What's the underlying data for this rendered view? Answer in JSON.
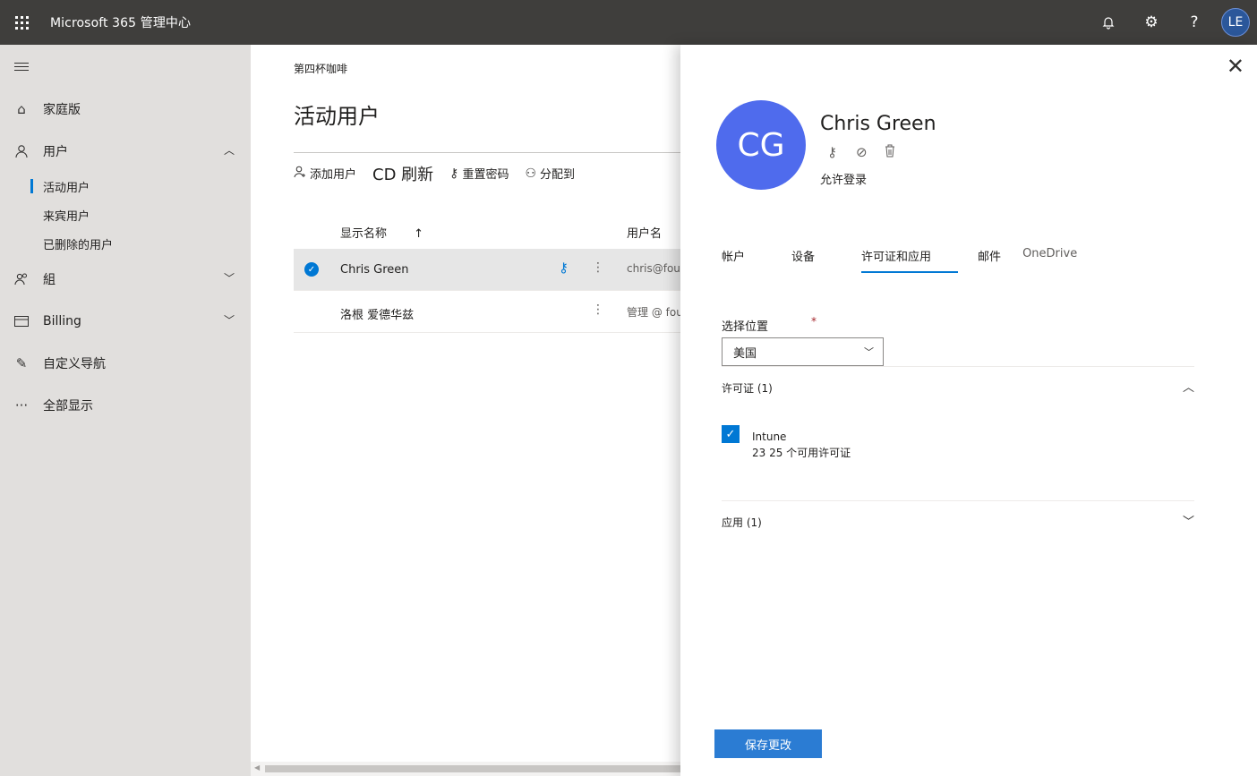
{
  "header": {
    "app_title": "Microsoft 365 管理中心",
    "avatar_initials": "LE",
    "help_glyph": "?"
  },
  "nav": {
    "home": "家庭版",
    "users": "用户",
    "users_sub": [
      "活动用户",
      "来宾用户",
      "已删除的用户"
    ],
    "groups": "組",
    "billing": "Billing",
    "customize": "自定义导航",
    "show_all": "全部显示"
  },
  "main": {
    "org": "第四杯咖啡",
    "title": "活动用户",
    "commands": {
      "add_user": "添加用户",
      "refresh": "CD 刷新",
      "reset_password": "重置密码",
      "assign": "分配到"
    },
    "columns": {
      "display_name": "显示名称",
      "sort_arrow": "↑",
      "username": "用户名"
    },
    "rows": [
      {
        "name": "Chris Green",
        "username": "chris@fou"
      },
      {
        "name": "洛根 爱德华兹",
        "username": "管理 @ fou"
      }
    ]
  },
  "panel": {
    "initials": "CG",
    "user_name": "Chris Green",
    "signin_status": "允许登录",
    "tabs": [
      "帐户",
      "设备",
      "许可证和应用",
      "邮件",
      "OneDrive"
    ],
    "location_label": "选择位置",
    "required_mark": "*",
    "location_value": "美国",
    "licenses_title": "许可证 (1)",
    "license_name": "Intune",
    "license_count": "23 25 个可用许可证",
    "apps_title": "应用 (1)",
    "save_button": "保存更改"
  },
  "colors": {
    "topbar": "#3f3e3c",
    "nav_bg": "#e1dfdd",
    "accent": "#0078d4",
    "avatar": "#4f6bed"
  }
}
